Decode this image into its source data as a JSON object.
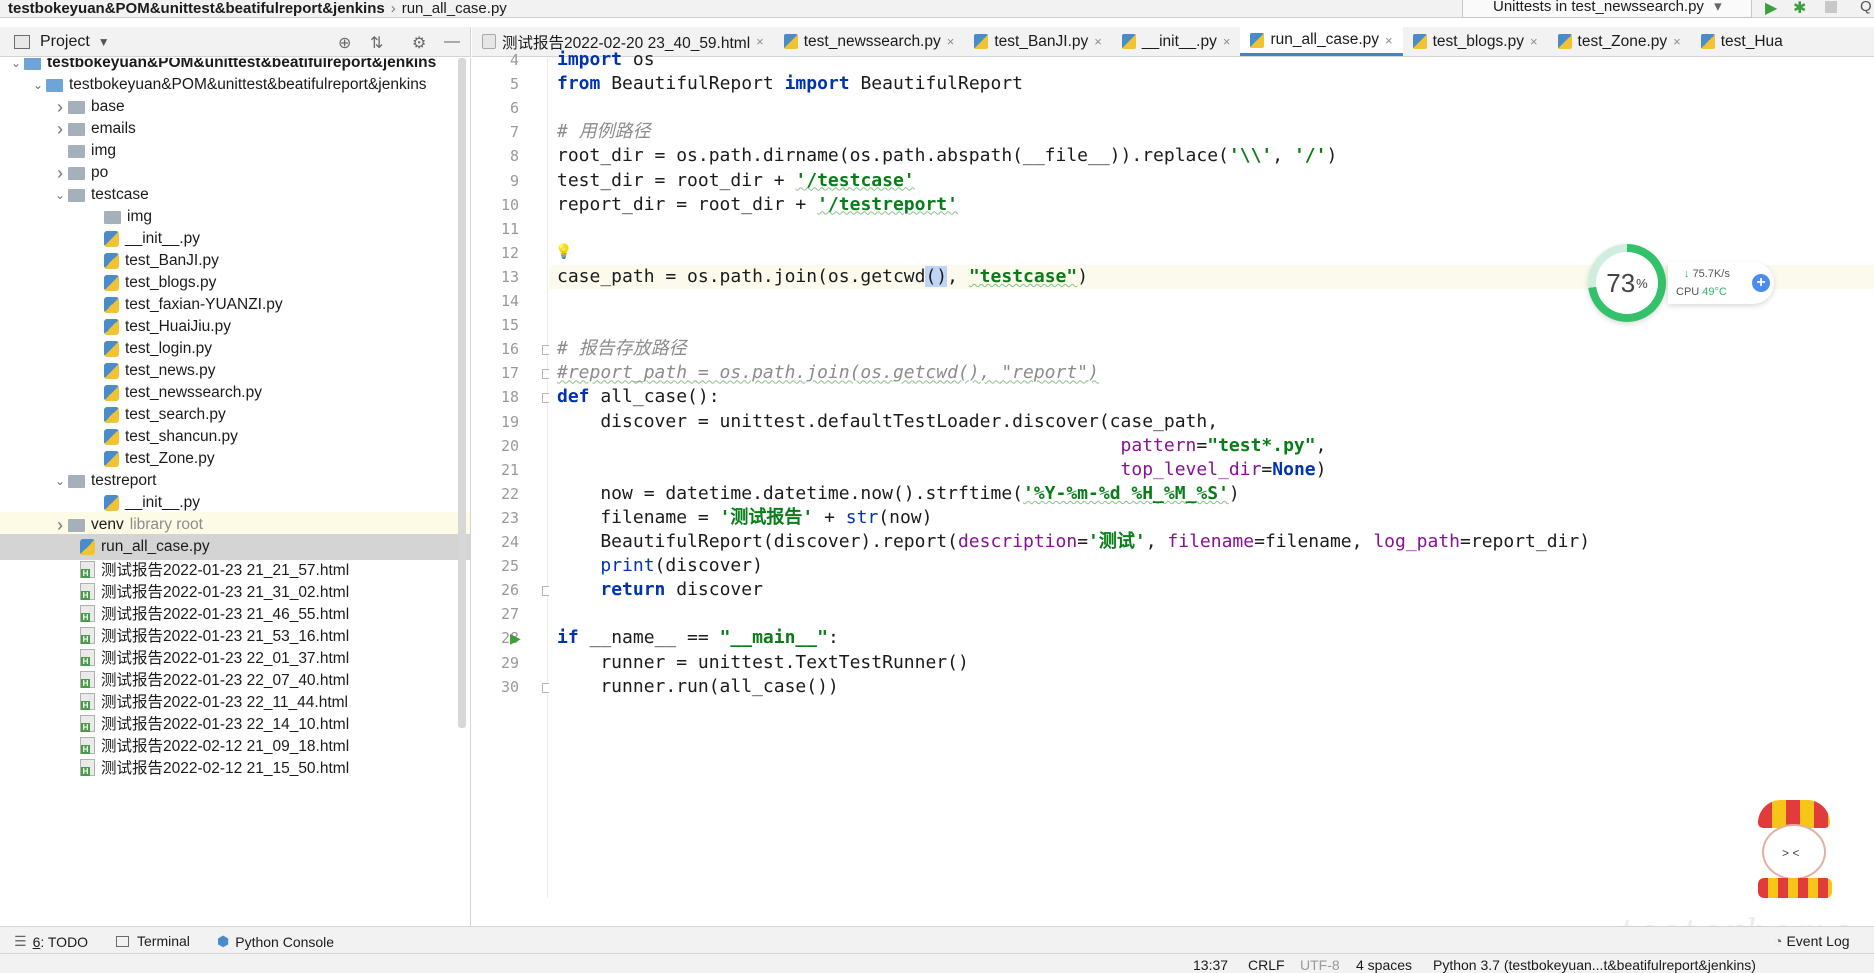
{
  "navbar": {
    "crumbs": [
      "testbokeyuan&POM&unittest&beatifulreport&jenkins",
      "run_all_case.py"
    ],
    "run_config": "Unittests in test_newssearch.py"
  },
  "project": {
    "label": "Project"
  },
  "tree": [
    {
      "label": "testbokeyuan&POM&unittest&beatifulreport&jenkins",
      "bold": true,
      "arrow": "down",
      "indent": 8,
      "icon": "folder-icon"
    },
    {
      "label": "testbokeyuan&POM&unittest&beatifulreport&jenkins",
      "bold": false,
      "arrow": "down",
      "indent": 30,
      "icon": "folder-icon"
    },
    {
      "label": "base",
      "arrow": "right",
      "indent": 52,
      "icon": "folder-icon"
    },
    {
      "label": "emails",
      "arrow": "right",
      "indent": 52,
      "icon": "folder-icon"
    },
    {
      "label": "img",
      "arrow": "",
      "indent": 52,
      "icon": "folder-icon"
    },
    {
      "label": "po",
      "arrow": "right",
      "indent": 52,
      "icon": "folder-icon"
    },
    {
      "label": "testcase",
      "arrow": "down",
      "indent": 52,
      "icon": "folder-icon"
    },
    {
      "label": "img",
      "arrow": "",
      "indent": 88,
      "icon": "folder-icon"
    },
    {
      "label": "__init__.py",
      "arrow": "",
      "indent": 88,
      "icon": "python-file-icon"
    },
    {
      "label": "test_BanJI.py",
      "arrow": "",
      "indent": 88,
      "icon": "python-file-icon"
    },
    {
      "label": "test_blogs.py",
      "arrow": "",
      "indent": 88,
      "icon": "python-file-icon"
    },
    {
      "label": "test_faxian-YUANZI.py",
      "arrow": "",
      "indent": 88,
      "icon": "python-file-icon"
    },
    {
      "label": "test_HuaiJiu.py",
      "arrow": "",
      "indent": 88,
      "icon": "python-file-icon"
    },
    {
      "label": "test_login.py",
      "arrow": "",
      "indent": 88,
      "icon": "python-file-icon"
    },
    {
      "label": "test_news.py",
      "arrow": "",
      "indent": 88,
      "icon": "python-file-icon"
    },
    {
      "label": "test_newssearch.py",
      "arrow": "",
      "indent": 88,
      "icon": "python-file-icon"
    },
    {
      "label": "test_search.py",
      "arrow": "",
      "indent": 88,
      "icon": "python-file-icon"
    },
    {
      "label": "test_shancun.py",
      "arrow": "",
      "indent": 88,
      "icon": "python-file-icon"
    },
    {
      "label": "test_Zone.py",
      "arrow": "",
      "indent": 88,
      "icon": "python-file-icon"
    },
    {
      "label": "testreport",
      "arrow": "down",
      "indent": 52,
      "icon": "folder-icon"
    },
    {
      "label": "__init__.py",
      "arrow": "",
      "indent": 88,
      "icon": "python-file-icon"
    },
    {
      "label": "venv",
      "arrow": "right",
      "indent": 52,
      "icon": "folder-icon",
      "suffix": "library root",
      "venv": true
    },
    {
      "label": "run_all_case.py",
      "arrow": "",
      "indent": 64,
      "icon": "python-file-icon",
      "selected": true
    },
    {
      "label": "测试报告2022-01-23 21_21_57.html",
      "arrow": "",
      "indent": 64,
      "icon": "html-file-icon"
    },
    {
      "label": "测试报告2022-01-23 21_31_02.html",
      "arrow": "",
      "indent": 64,
      "icon": "html-file-icon"
    },
    {
      "label": "测试报告2022-01-23 21_46_55.html",
      "arrow": "",
      "indent": 64,
      "icon": "html-file-icon"
    },
    {
      "label": "测试报告2022-01-23 21_53_16.html",
      "arrow": "",
      "indent": 64,
      "icon": "html-file-icon"
    },
    {
      "label": "测试报告2022-01-23 22_01_37.html",
      "arrow": "",
      "indent": 64,
      "icon": "html-file-icon"
    },
    {
      "label": "测试报告2022-01-23 22_07_40.html",
      "arrow": "",
      "indent": 64,
      "icon": "html-file-icon"
    },
    {
      "label": "测试报告2022-01-23 22_11_44.html",
      "arrow": "",
      "indent": 64,
      "icon": "html-file-icon"
    },
    {
      "label": "测试报告2022-01-23 22_14_10.html",
      "arrow": "",
      "indent": 64,
      "icon": "html-file-icon"
    },
    {
      "label": "测试报告2022-02-12 21_09_18.html",
      "arrow": "",
      "indent": 64,
      "icon": "html-file-icon"
    },
    {
      "label": "测试报告2022-02-12 21_15_50.html",
      "arrow": "",
      "indent": 64,
      "icon": "html-file-icon"
    }
  ],
  "tabs": [
    {
      "label": "测试报告2022-02-20 23_40_59.html",
      "icon": "html-file-icon",
      "active": false
    },
    {
      "label": "test_newssearch.py",
      "icon": "python-file-icon",
      "active": false
    },
    {
      "label": "test_BanJI.py",
      "icon": "python-file-icon",
      "active": false
    },
    {
      "label": "__init__.py",
      "icon": "python-file-icon",
      "active": false
    },
    {
      "label": "run_all_case.py",
      "icon": "python-file-icon",
      "active": true
    },
    {
      "label": "test_blogs.py",
      "icon": "python-file-icon",
      "active": false
    },
    {
      "label": "test_Zone.py",
      "icon": "python-file-icon",
      "active": false
    },
    {
      "label": "test_Hua",
      "icon": "python-file-icon",
      "active": false
    }
  ],
  "editor": {
    "first_line": 4,
    "current_line": 13,
    "lines": [
      [
        [
          "kw",
          "import"
        ],
        [
          "",
          "&nbsp;os"
        ]
      ],
      [
        [
          "kw",
          "from"
        ],
        [
          "",
          "&nbsp;BeautifulReport&nbsp;"
        ],
        [
          "kw",
          "import"
        ],
        [
          "",
          "&nbsp;BeautifulReport"
        ]
      ],
      [],
      [
        [
          "cmt",
          "#&nbsp;用例路径"
        ]
      ],
      [
        [
          "",
          "root_dir&nbsp;=&nbsp;os.path.dirname(os.path.abspath(__file__)).replace("
        ],
        [
          "str",
          "'\\\\'"
        ],
        [
          "",
          ",&nbsp;"
        ],
        [
          "str",
          "'/'"
        ],
        [
          "",
          ")"
        ]
      ],
      [
        [
          "",
          "test_dir&nbsp;=&nbsp;root_dir&nbsp;+&nbsp;"
        ],
        [
          "str sq",
          "'/testcase'"
        ]
      ],
      [
        [
          "",
          "report_dir&nbsp;=&nbsp;root_dir&nbsp;+&nbsp;"
        ],
        [
          "str sq",
          "'/testreport'"
        ]
      ],
      [],
      [],
      [
        [
          "",
          "case_path&nbsp;=&nbsp;os.path.join(os.getcwd"
        ],
        [
          "hl-paren",
          "()"
        ],
        [
          "",
          ",&nbsp;"
        ],
        [
          "str sq",
          "\"testcase\""
        ],
        [
          "",
          ")"
        ]
      ],
      [],
      [],
      [
        [
          "cmt",
          "#&nbsp;报告存放路径"
        ]
      ],
      [
        [
          "cmt sq",
          "#report_path&nbsp;=&nbsp;os.path.join(os.getcwd(),&nbsp;\"report\")"
        ]
      ],
      [
        [
          "kw",
          "def"
        ],
        [
          "",
          "&nbsp;all_case():"
        ]
      ],
      [
        [
          "",
          "&nbsp;&nbsp;&nbsp;&nbsp;discover&nbsp;=&nbsp;unittest.defaultTestLoader.discover(case_path,"
        ]
      ],
      [
        [
          "",
          "&nbsp;&nbsp;&nbsp;&nbsp;&nbsp;&nbsp;&nbsp;&nbsp;&nbsp;&nbsp;&nbsp;&nbsp;&nbsp;&nbsp;&nbsp;&nbsp;&nbsp;&nbsp;&nbsp;&nbsp;&nbsp;&nbsp;&nbsp;&nbsp;&nbsp;&nbsp;&nbsp;&nbsp;&nbsp;&nbsp;&nbsp;&nbsp;&nbsp;&nbsp;&nbsp;&nbsp;&nbsp;&nbsp;&nbsp;&nbsp;&nbsp;&nbsp;&nbsp;&nbsp;&nbsp;&nbsp;&nbsp;&nbsp;&nbsp;&nbsp;&nbsp;&nbsp;"
        ],
        [
          "param",
          "pattern"
        ],
        [
          "",
          "="
        ],
        [
          "str",
          "\"test*.py\""
        ],
        [
          "",
          ","
        ]
      ],
      [
        [
          "",
          "&nbsp;&nbsp;&nbsp;&nbsp;&nbsp;&nbsp;&nbsp;&nbsp;&nbsp;&nbsp;&nbsp;&nbsp;&nbsp;&nbsp;&nbsp;&nbsp;&nbsp;&nbsp;&nbsp;&nbsp;&nbsp;&nbsp;&nbsp;&nbsp;&nbsp;&nbsp;&nbsp;&nbsp;&nbsp;&nbsp;&nbsp;&nbsp;&nbsp;&nbsp;&nbsp;&nbsp;&nbsp;&nbsp;&nbsp;&nbsp;&nbsp;&nbsp;&nbsp;&nbsp;&nbsp;&nbsp;&nbsp;&nbsp;&nbsp;&nbsp;&nbsp;&nbsp;"
        ],
        [
          "param",
          "top_level_dir"
        ],
        [
          "",
          "="
        ],
        [
          "kw",
          "None"
        ],
        [
          "",
          ")"
        ]
      ],
      [
        [
          "",
          "&nbsp;&nbsp;&nbsp;&nbsp;now&nbsp;=&nbsp;datetime.datetime.now().strftime("
        ],
        [
          "str sq",
          "'%Y-%m-%d&nbsp;%H_%M_%S'"
        ],
        [
          "",
          ")"
        ]
      ],
      [
        [
          "",
          "&nbsp;&nbsp;&nbsp;&nbsp;filename&nbsp;=&nbsp;"
        ],
        [
          "str",
          "'测试报告'"
        ],
        [
          "",
          "&nbsp;+&nbsp;"
        ],
        [
          "fn",
          "str"
        ],
        [
          "",
          "(now)"
        ]
      ],
      [
        [
          "",
          "&nbsp;&nbsp;&nbsp;&nbsp;BeautifulReport(discover).report("
        ],
        [
          "param",
          "description"
        ],
        [
          "",
          "="
        ],
        [
          "str",
          "'测试'"
        ],
        [
          "",
          ",&nbsp;"
        ],
        [
          "param",
          "filename"
        ],
        [
          "",
          "=filename,&nbsp;"
        ],
        [
          "param",
          "log_path"
        ],
        [
          "",
          "=report_dir)"
        ]
      ],
      [
        [
          "",
          "&nbsp;&nbsp;&nbsp;&nbsp;"
        ],
        [
          "fn",
          "print"
        ],
        [
          "",
          "(discover)"
        ]
      ],
      [
        [
          "",
          "&nbsp;&nbsp;&nbsp;&nbsp;"
        ],
        [
          "kw",
          "return"
        ],
        [
          "",
          "&nbsp;discover"
        ]
      ],
      [],
      [
        [
          "kw",
          "if"
        ],
        [
          "",
          "&nbsp;__name__&nbsp;==&nbsp;"
        ],
        [
          "str",
          "\"__main__\""
        ],
        [
          "",
          ":"
        ]
      ],
      [
        [
          "",
          "&nbsp;&nbsp;&nbsp;&nbsp;runner&nbsp;=&nbsp;unittest.TextTestRunner()"
        ]
      ],
      [
        [
          "",
          "&nbsp;&nbsp;&nbsp;&nbsp;runner.run(all_case())"
        ]
      ]
    ]
  },
  "widget": {
    "percent_value": 73,
    "percent_text": "73",
    "percent_unit": "%",
    "speed": "75.7K/s",
    "cpu_label": "CPU",
    "cpu_temp": "49°C"
  },
  "watermark": "testerhome",
  "toolwindows": {
    "todo_number": "6",
    "todo_label": ": TODO",
    "terminal": "Terminal",
    "python_console": "Python Console",
    "event_log": "Event Log"
  },
  "status": {
    "position": "13:37",
    "line_sep": "CRLF",
    "encoding": "UTF-8",
    "indent": "4 spaces",
    "interpreter": "Python 3.7 (testbokeyuan...t&beatifulreport&jenkins)"
  }
}
